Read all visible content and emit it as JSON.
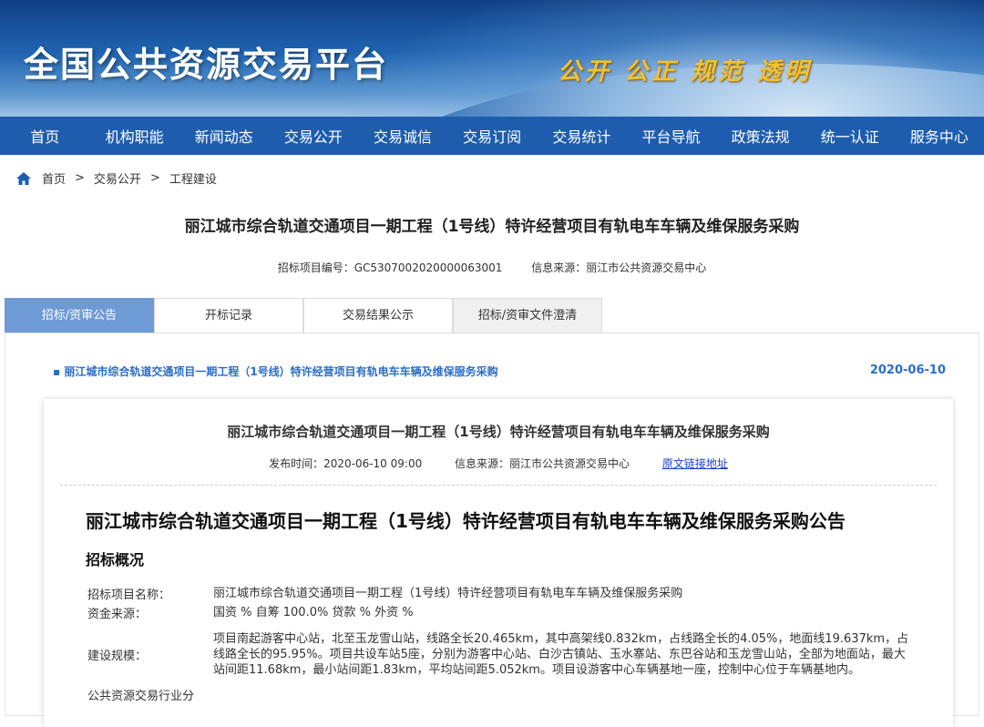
{
  "banner": {
    "title": "全国公共资源交易平台",
    "slogan": "公开 公正 规范 透明"
  },
  "nav": [
    "首页",
    "机构职能",
    "新闻动态",
    "交易公开",
    "交易诚信",
    "交易订阅",
    "交易统计",
    "平台导航",
    "政策法规",
    "统一认证",
    "服务中心"
  ],
  "breadcrumb": {
    "home": "首页",
    "level1": "交易公开",
    "level2": "工程建设",
    "separator": ">"
  },
  "project": {
    "title": "丽江城市综合轨道交通项目一期工程（1号线）特许经营项目有轨电车车辆及维保服务采购",
    "code": "招标项目编号：GC5307002020000063001",
    "source": "信息来源：丽江市公共资源交易中心"
  },
  "tabs": [
    "招标/资审公告",
    "开标记录",
    "交易结果公示",
    "招标/资审文件澄清"
  ],
  "notice": {
    "link": "丽江城市综合轨道交通项目一期工程（1号线）特许经营项目有轨电车车辆及维保服务采购",
    "date": "2020-06-10"
  },
  "card": {
    "title": "丽江城市综合轨道交通项目一期工程（1号线）特许经营项目有轨电车车辆及维保服务采购",
    "publish_time": "发布时间：2020-06-10 09:00",
    "source": "信息来源：丽江市公共资源交易中心",
    "original_link": "原文链接地址",
    "doc_title": "丽江城市综合轨道交通项目一期工程（1号线）特许经营项目有轨电车车辆及维保服务采购公告",
    "section": "招标概况",
    "fields": [
      {
        "key": "招标项目名称：",
        "value": "丽江城市综合轨道交通项目一期工程（1号线）特许经营项目有轨电车车辆及维保服务采购"
      },
      {
        "key": "资金来源：",
        "value": "国资 % 自筹 100.0% 贷款 % 外资 %"
      },
      {
        "key": "建设规模：",
        "value": "项目南起游客中心站，北至玉龙雪山站，线路全长20.465km，其中高架线0.832km，占线路全长的4.05%，地面线19.637km，占线路全长的95.95%。项目共设车站5座，分别为游客中心站、白沙古镇站、玉水寨站、东巴谷站和玉龙雪山站，全部为地面站，最大站间距11.68km，最小站间距1.83km，平均站间距5.052km。项目设游客中心车辆基地一座，控制中心位于车辆基地内。"
      },
      {
        "key": "公共资源交易行业分",
        "value": ""
      }
    ]
  }
}
